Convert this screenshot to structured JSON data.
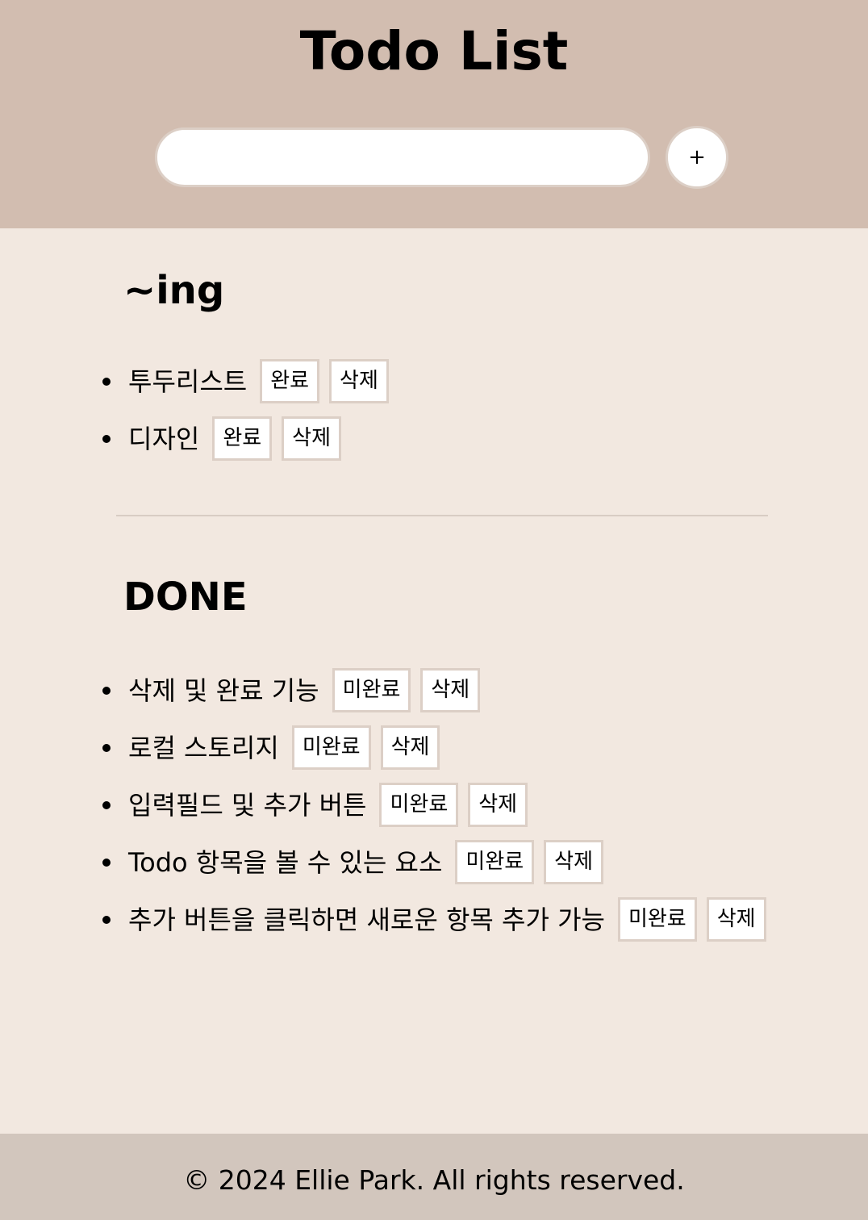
{
  "header": {
    "title": "Todo List",
    "input_value": "",
    "input_placeholder": "",
    "add_label": "+"
  },
  "ing": {
    "title": "~ing",
    "items": [
      {
        "text": "투두리스트",
        "toggle_label": "완료",
        "delete_label": "삭제"
      },
      {
        "text": "디자인",
        "toggle_label": "완료",
        "delete_label": "삭제"
      }
    ]
  },
  "done": {
    "title": "DONE",
    "items": [
      {
        "text": "삭제 및 완료 기능",
        "toggle_label": "미완료",
        "delete_label": "삭제"
      },
      {
        "text": "로컬 스토리지",
        "toggle_label": "미완료",
        "delete_label": "삭제"
      },
      {
        "text": "입력필드 및 추가 버튼",
        "toggle_label": "미완료",
        "delete_label": "삭제"
      },
      {
        "text": "Todo 항목을 볼 수 있는 요소",
        "toggle_label": "미완료",
        "delete_label": "삭제"
      },
      {
        "text": "추가 버튼을 클릭하면 새로운 항목 추가 가능",
        "toggle_label": "미완료",
        "delete_label": "삭제"
      }
    ]
  },
  "footer": {
    "text": "© 2024 Ellie Park. All rights reserved."
  },
  "colors": {
    "header_bg": "#d2bdb0",
    "page_bg": "#f2e8e0",
    "footer_bg": "#d2c6bd",
    "button_border": "#dccfc6"
  }
}
